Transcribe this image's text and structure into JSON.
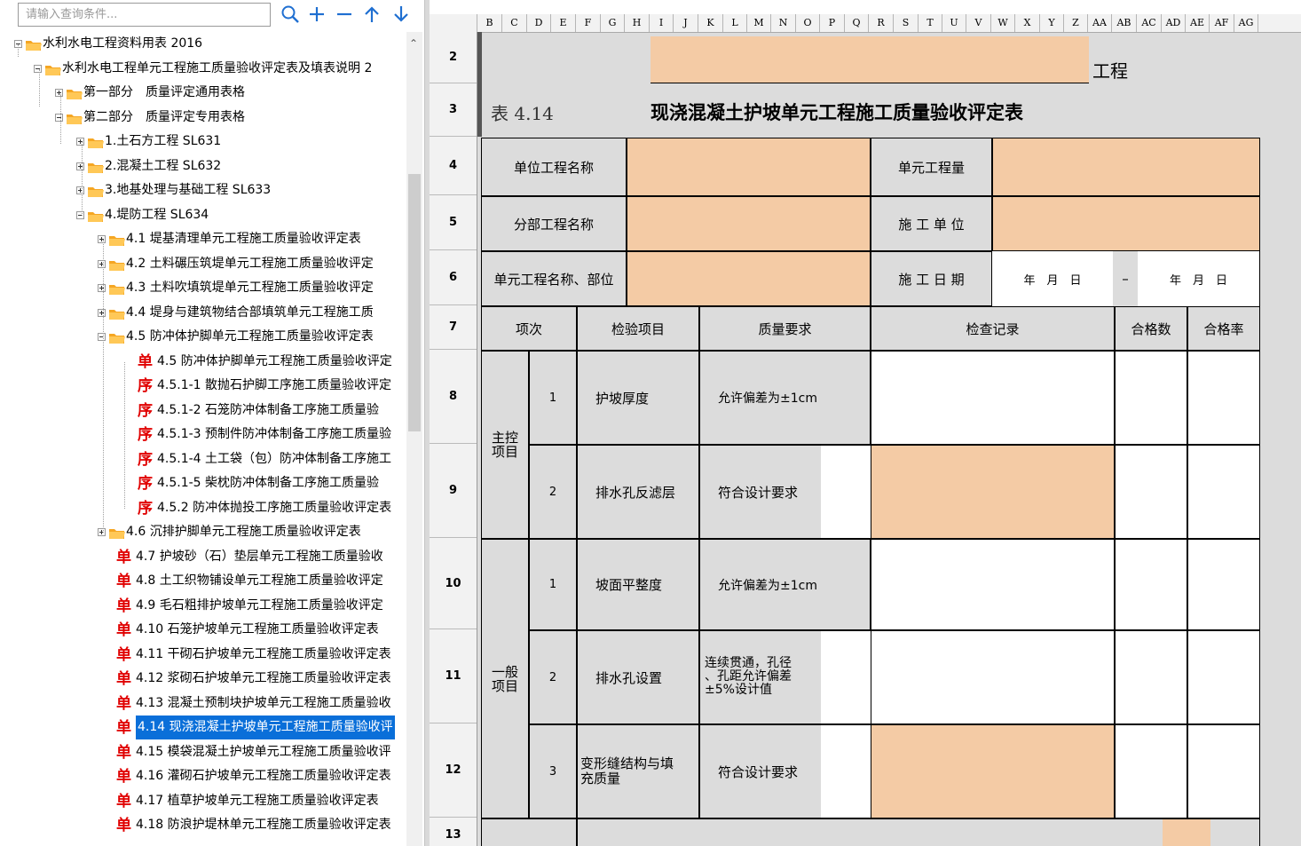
{
  "search": {
    "placeholder": "请输入查询条件..."
  },
  "toolbar": {
    "icons": [
      "search-icon",
      "plus-icon",
      "minus-icon",
      "arrow-up-icon",
      "arrow-down-icon"
    ]
  },
  "tree": {
    "root": "水利水电工程资料用表 2016",
    "n1": "水利水电工程单元工程施工质量验收评定表及填表说明 2",
    "n2": "第一部分　质量评定通用表格",
    "n3": "第二部分　质量评定专用表格",
    "n4": "1.土石方工程 SL631",
    "n5": "2.混凝土工程 SL632",
    "n6": "3.地基处理与基础工程 SL633",
    "n7": "4.堤防工程 SL634",
    "n8": "4.1 堤基清理单元工程施工质量验收评定表",
    "n9": "4.2 土料碾压筑堤单元工程施工质量验收评定",
    "n10": "4.3 土料吹填筑堤单元工程施工质量验收评定",
    "n11": "4.4 堤身与建筑物结合部填筑单元工程施工质",
    "n12": "4.5 防冲体护脚单元工程施工质量验收评定表",
    "n13": "4.5 防冲体护脚单元工程施工质量验收评定",
    "n14": "4.5.1-1 散抛石护脚工序施工质量验收评定",
    "n15": "4.5.1-2 石笼防冲体制备工序施工质量验",
    "n16": "4.5.1-3 预制件防冲体制备工序施工质量验",
    "n17": "4.5.1-4 土工袋（包）防冲体制备工序施工",
    "n18": "4.5.1-5 柴枕防冲体制备工序施工质量验",
    "n19": "4.5.2 防冲体抛投工序施工质量验收评定表",
    "n20": "4.6 沉排护脚单元工程施工质量验收评定表",
    "n21": "4.7 护坡砂（石）垫层单元工程施工质量验收",
    "n22": "4.8 土工织物铺设单元工程施工质量验收评定",
    "n23": "4.9 毛石粗排护坡单元工程施工质量验收评定",
    "n24": "4.10 石笼护坡单元工程施工质量验收评定表",
    "n25": "4.11 干砌石护坡单元工程施工质量验收评定表",
    "n26": "4.12 浆砌石护坡单元工程施工质量验收评定表",
    "n27": "4.13 混凝土预制块护坡单元工程施工质量验收",
    "n28": "4.14 现浇混凝土护坡单元工程施工质量验收评",
    "n29": "4.15 模袋混凝土护坡单元工程施工质量验收评",
    "n30": "4.16 灌砌石护坡单元工程施工质量验收评定表",
    "n31": "4.17 植草护坡单元工程施工质量验收评定表",
    "n32": "4.18 防浪护堤林单元工程施工质量验收评定表",
    "badge_dan": "单",
    "badge_xu": "序"
  },
  "sheet": {
    "columns": [
      "B",
      "C",
      "D",
      "E",
      "F",
      "G",
      "H",
      "I",
      "J",
      "K",
      "L",
      "M",
      "N",
      "O",
      "P",
      "Q",
      "R",
      "S",
      "T",
      "U",
      "V",
      "W",
      "X",
      "Y",
      "Z",
      "AA",
      "AB",
      "AC",
      "AD",
      "AE",
      "AF",
      "AG"
    ],
    "rows": [
      "2",
      "3",
      "4",
      "5",
      "6",
      "7",
      "8",
      "9",
      "10",
      "11",
      "12",
      "13"
    ],
    "gongcheng": "工程",
    "table_no": "表 4.14",
    "title": "现浇混凝土护坡单元工程施工质量验收评定表",
    "unit_name_label": "单位工程名称",
    "unit_qty_label": "单元工程量",
    "div_name_label": "分部工程名称",
    "constructor_label": "施 工 单 位",
    "unit_part_label": "单元工程名称、部位",
    "date_label": "施 工 日 期",
    "date_from": "年　月　日",
    "date_dash": "–",
    "date_to": "年　月　日",
    "hdr_item_no": "项次",
    "hdr_check_item": "检验项目",
    "hdr_quality_req": "质量要求",
    "hdr_record": "检查记录",
    "hdr_pass_count": "合格数",
    "hdr_pass_rate": "合格率",
    "main_group": "主控\n项目",
    "general_group": "一般\n项目",
    "r8_no": "1",
    "r8_item": "护坡厚度",
    "r8_req": "允许偏差为±1cm",
    "r9_no": "2",
    "r9_item": "排水孔反滤层",
    "r9_req": "符合设计要求",
    "r10_no": "1",
    "r10_item": "坡面平整度",
    "r10_req": "允许偏差为±1cm",
    "r11_no": "2",
    "r11_item": "排水孔设置",
    "r11_req": "连续贯通，孔径\n、孔距允许偏差\n±5%设计值",
    "r12_no": "3",
    "r12_item": "变形缝结构与填\n充质量",
    "r12_req": "符合设计要求"
  }
}
